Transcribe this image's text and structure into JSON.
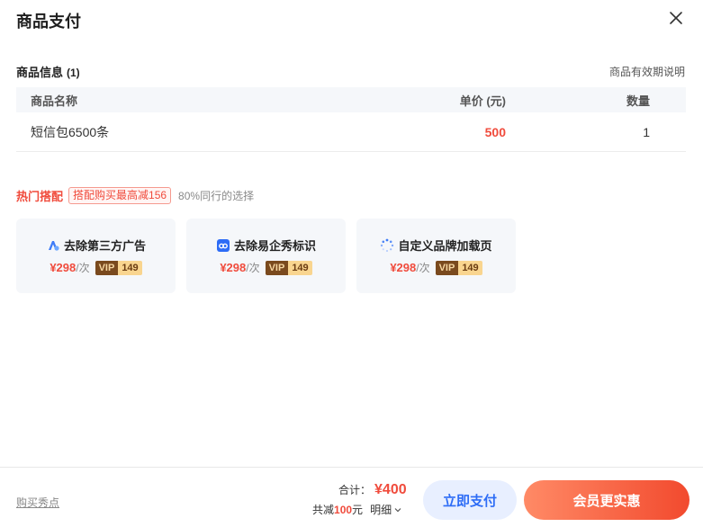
{
  "header": {
    "title": "商品支付",
    "close_icon": "close-icon"
  },
  "product_info": {
    "title": "商品信息",
    "count": "(1)",
    "validity_link": "商品有效期说明",
    "columns": {
      "name": "商品名称",
      "price": "单价 (元)",
      "qty": "数量"
    },
    "rows": [
      {
        "name": "短信包6500条",
        "price": "500",
        "qty": "1"
      }
    ]
  },
  "hot": {
    "title": "热门搭配",
    "badge": "搭配购买最高减156",
    "subtitle": "80%同行的选择",
    "cards": [
      {
        "icon": "ad-remove-icon",
        "title": "去除第三方广告",
        "price": "¥298",
        "unit": "/次",
        "vip_label": "VIP",
        "vip_price": "149"
      },
      {
        "icon": "logo-remove-icon",
        "title": "去除易企秀标识",
        "price": "¥298",
        "unit": "/次",
        "vip_label": "VIP",
        "vip_price": "149"
      },
      {
        "icon": "loading-page-icon",
        "title": "自定义品牌加载页",
        "price": "¥298",
        "unit": "/次",
        "vip_label": "VIP",
        "vip_price": "149"
      }
    ]
  },
  "footer": {
    "buy_link": "购买秀点",
    "total_label": "合计：",
    "total_amount": "¥400",
    "discount_prefix": "共减",
    "discount_value": "100",
    "discount_suffix": "元",
    "detail_label": "明细",
    "pay_button": "立即支付",
    "vip_button": "会员更实惠"
  },
  "colors": {
    "accent_red": "#f04b3c",
    "accent_blue": "#2d6cf6"
  }
}
